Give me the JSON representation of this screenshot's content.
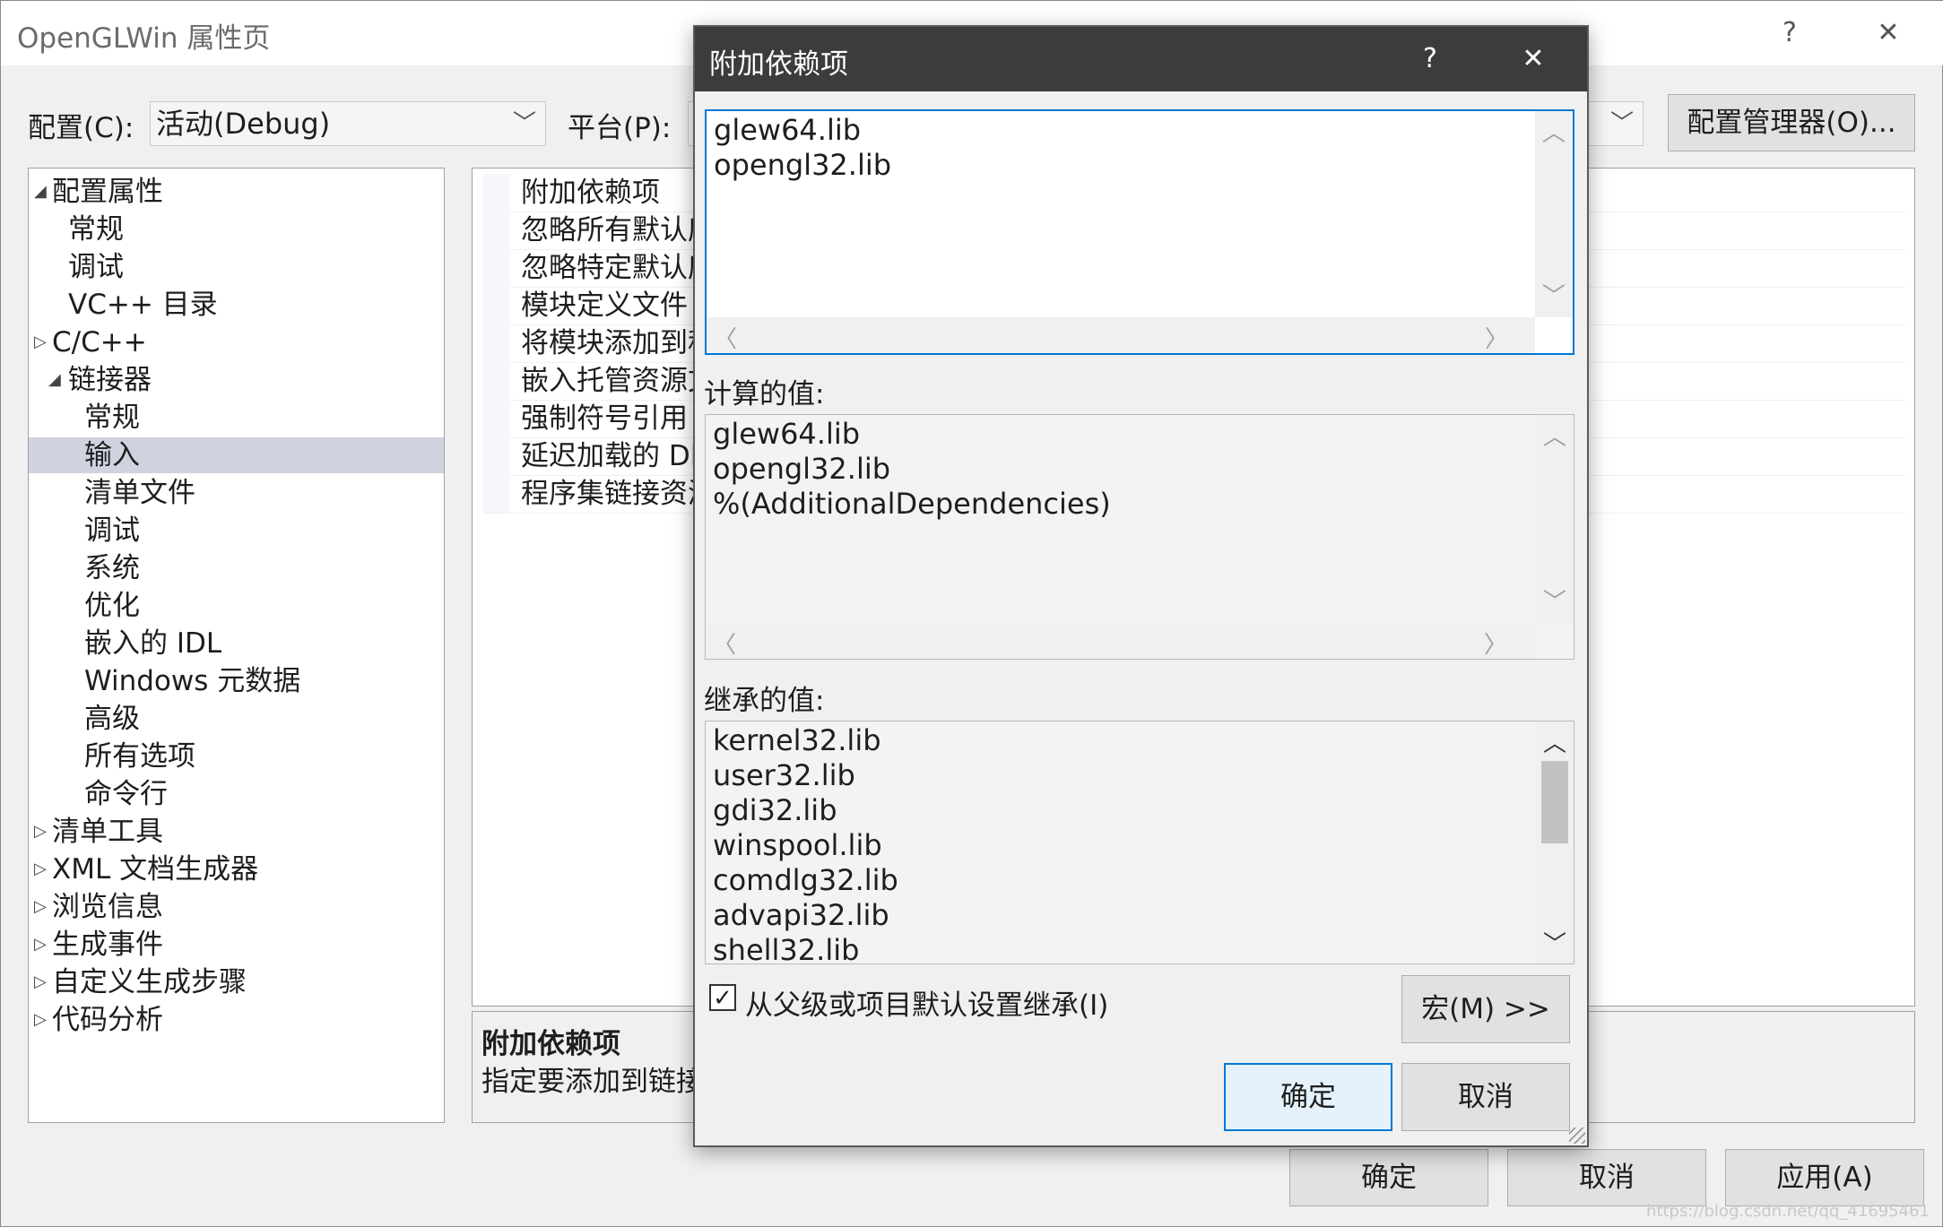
{
  "main": {
    "title": "OpenGLWin 属性页",
    "help_glyph": "?",
    "close_glyph": "✕",
    "config_label": "配置(C):",
    "config_value": "活动(Debug)",
    "platform_label": "平台(P):",
    "config_manager_label": "配置管理器(O)..."
  },
  "tree": {
    "items": [
      {
        "label": "配置属性",
        "glyph": "◢"
      },
      {
        "label": "常规"
      },
      {
        "label": "调试"
      },
      {
        "label": "VC++ 目录"
      },
      {
        "label": "C/C++",
        "glyph": "▷"
      },
      {
        "label": "链接器",
        "glyph": "◢"
      },
      {
        "label": "常规"
      },
      {
        "label": "输入"
      },
      {
        "label": "清单文件"
      },
      {
        "label": "调试"
      },
      {
        "label": "系统"
      },
      {
        "label": "优化"
      },
      {
        "label": "嵌入的 IDL"
      },
      {
        "label": "Windows 元数据"
      },
      {
        "label": "高级"
      },
      {
        "label": "所有选项"
      },
      {
        "label": "命令行"
      },
      {
        "label": "清单工具",
        "glyph": "▷"
      },
      {
        "label": "XML 文档生成器",
        "glyph": "▷"
      },
      {
        "label": "浏览信息",
        "glyph": "▷"
      },
      {
        "label": "生成事件",
        "glyph": "▷"
      },
      {
        "label": "自定义生成步骤",
        "glyph": "▷"
      },
      {
        "label": "代码分析",
        "glyph": "▷"
      }
    ]
  },
  "props": {
    "rows": [
      "附加依赖项",
      "忽略所有默认库",
      "忽略特定默认库",
      "模块定义文件",
      "将模块添加到程",
      "嵌入托管资源文",
      "强制符号引用",
      "延迟加载的 DL",
      "程序集链接资源"
    ]
  },
  "description": {
    "title": "附加依赖项",
    "text": "指定要添加到链接"
  },
  "footer": {
    "ok_label": "确定",
    "cancel_label": "取消",
    "apply_label": "应用(A)"
  },
  "dialog": {
    "title": "附加依赖项",
    "help_glyph": "?",
    "close_glyph": "✕",
    "edit_lines": [
      "glew64.lib",
      "opengl32.lib"
    ],
    "computed_label": "计算的值:",
    "computed_lines": [
      "glew64.lib",
      "opengl32.lib",
      "%(AdditionalDependencies)"
    ],
    "inherited_label": "继承的值:",
    "inherited_lines": [
      "kernel32.lib",
      "user32.lib",
      "gdi32.lib",
      "winspool.lib",
      "comdlg32.lib",
      "advapi32.lib",
      "shell32.lib"
    ],
    "inherit_checkbox_label": "从父级或项目默认设置继承(I)",
    "inherit_checked": true,
    "check_glyph": "✓",
    "macro_label": "宏(M) >>",
    "ok_label": "确定",
    "cancel_label": "取消"
  },
  "scroll_glyphs": {
    "up": "︿",
    "down": "﹀",
    "left": "〈",
    "right": "〉"
  },
  "chevron_glyph": "﹀",
  "watermark": "https://blog.csdn.net/qq_41695461"
}
